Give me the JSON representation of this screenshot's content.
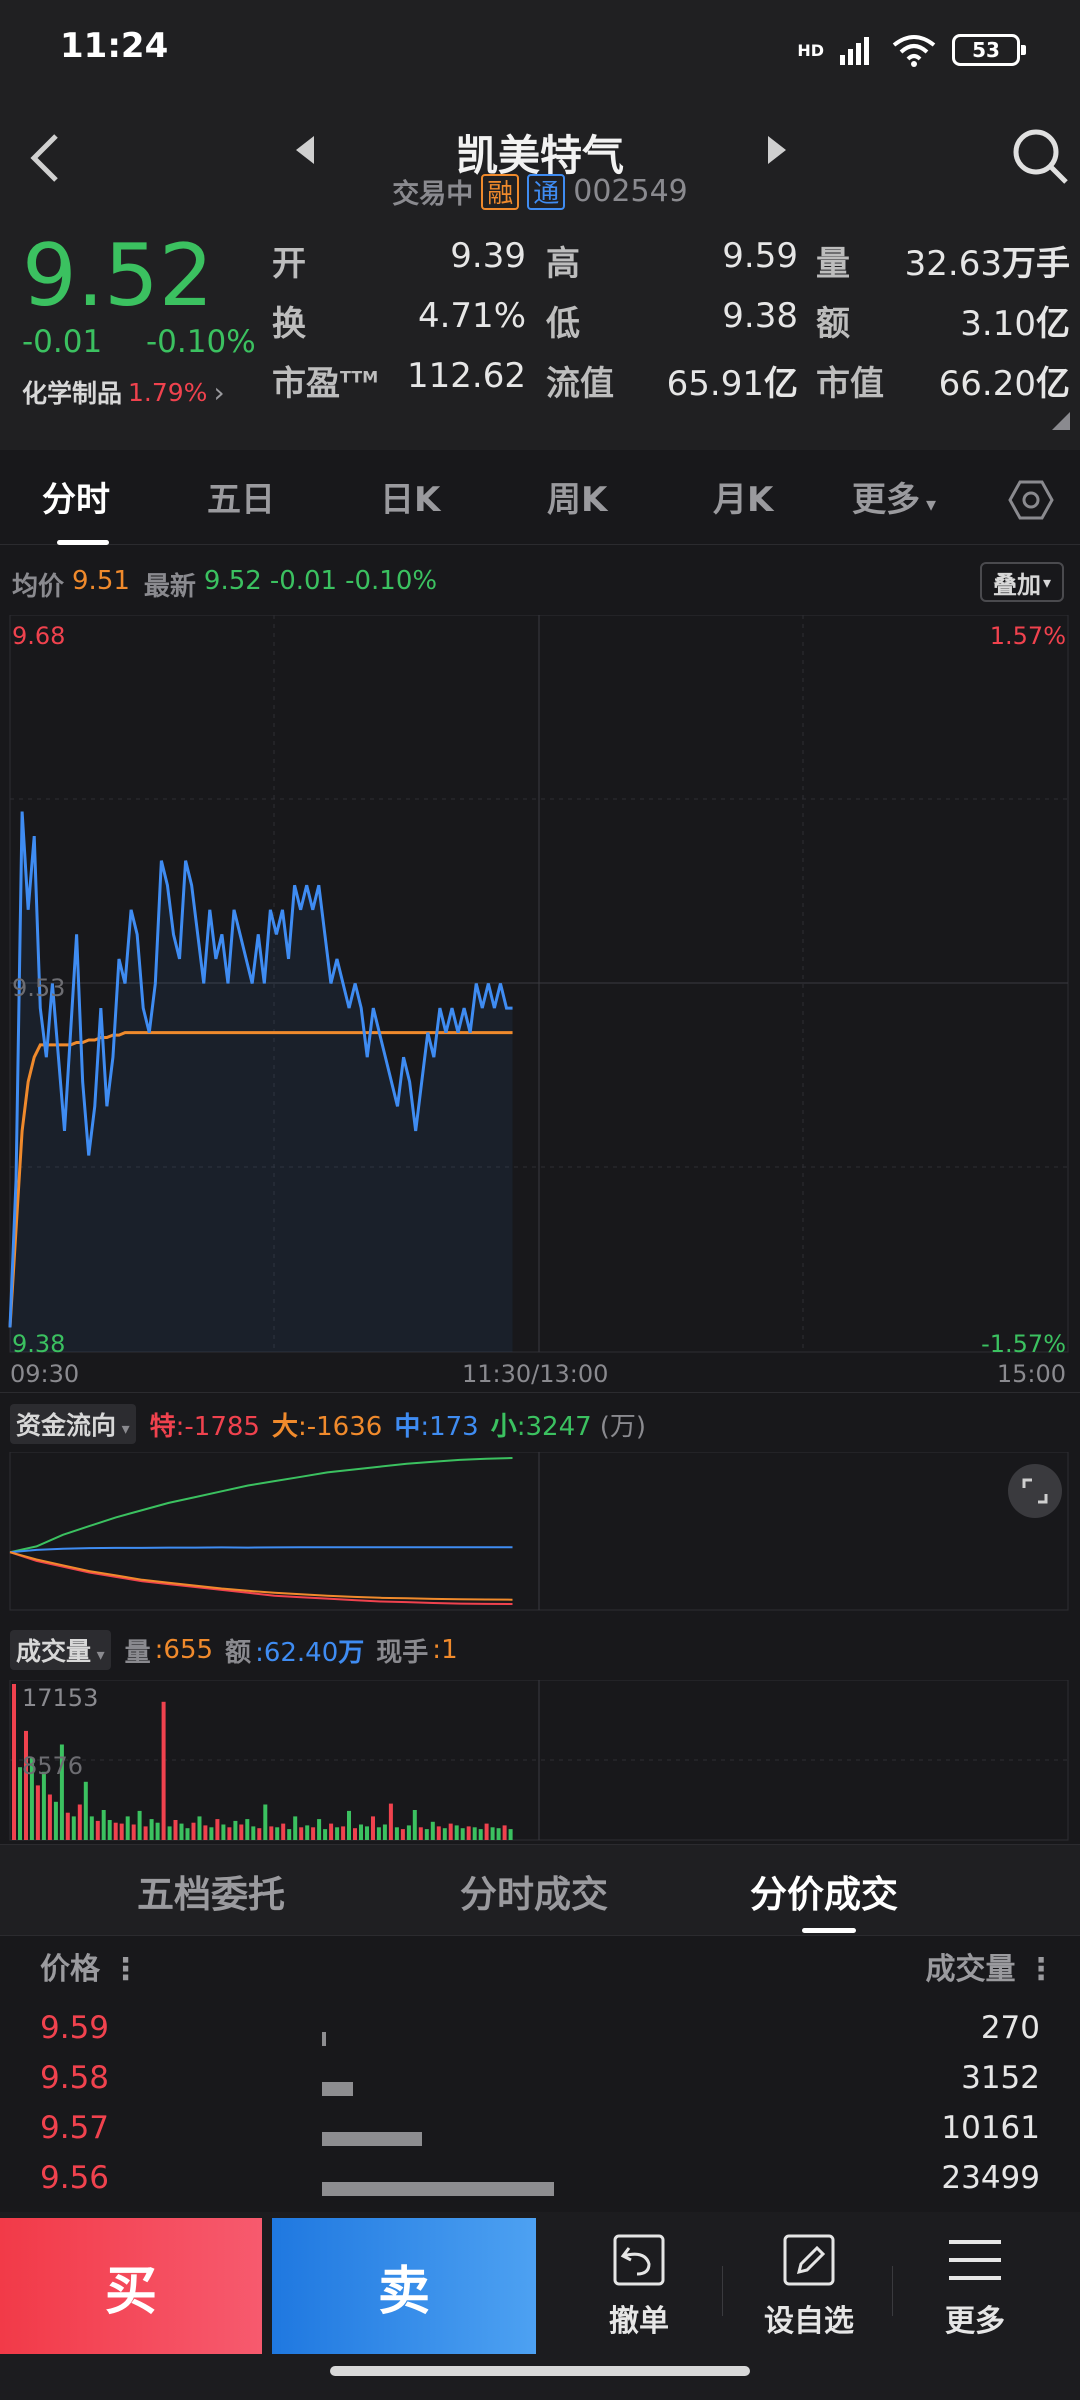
{
  "status_bar": {
    "time": "11:24",
    "network": "HD",
    "battery": "53"
  },
  "header": {
    "stock_name": "凯美特气",
    "trading_status": "交易中",
    "tag_rong": "融",
    "tag_tong": "通",
    "code": "002549",
    "price": "9.52",
    "change_abs": "-0.01",
    "change_pct": "-0.10%",
    "sector_name": "化学制品",
    "sector_change": "1.79%",
    "stats": [
      {
        "label": "开",
        "value": "9.39",
        "color": "green"
      },
      {
        "label": "高",
        "value": "9.59",
        "color": "red"
      },
      {
        "label": "量",
        "value": "32.63",
        "unit": "万手",
        "color": "white"
      },
      {
        "label": "换",
        "value": "4.71%",
        "color": "white"
      },
      {
        "label": "低",
        "value": "9.38",
        "color": "green"
      },
      {
        "label": "额",
        "value": "3.10",
        "unit": "亿",
        "color": "white"
      },
      {
        "label": "市盈",
        "label_sup": "TTM",
        "value": "112.62",
        "color": "white"
      },
      {
        "label": "流值",
        "value": "65.91",
        "unit": "亿",
        "color": "white"
      },
      {
        "label": "市值",
        "value": "66.20",
        "unit": "亿",
        "color": "white"
      }
    ]
  },
  "tabs": [
    "分时",
    "五日",
    "日K",
    "周K",
    "月K",
    "更多"
  ],
  "active_tab": "分时",
  "intraday_info": {
    "avg_label": "均价",
    "avg_value": "9.51",
    "latest_label": "最新",
    "latest_value": "9.52",
    "change_abs": "-0.01",
    "change_pct": "-0.10%",
    "overlay_label": "叠加"
  },
  "chart_data": [
    {
      "type": "line",
      "x_ticks": [
        "09:30",
        "11:30/13:00",
        "15:00"
      ],
      "y_max": "9.68",
      "y_min": "9.38",
      "y_mid": "9.53",
      "pct_max": "1.57%",
      "pct_min": "-1.57%",
      "ylim": [
        9.38,
        9.68
      ],
      "series": [
        {
          "key": "price",
          "color": "#3f8cf2",
          "values": [
            9.39,
            9.45,
            9.6,
            9.56,
            9.59,
            9.52,
            9.5,
            9.53,
            9.5,
            9.47,
            9.51,
            9.55,
            9.49,
            9.46,
            9.48,
            9.52,
            9.48,
            9.5,
            9.54,
            9.53,
            9.56,
            9.55,
            9.52,
            9.51,
            9.53,
            9.58,
            9.57,
            9.55,
            9.54,
            9.58,
            9.57,
            9.55,
            9.53,
            9.56,
            9.54,
            9.55,
            9.53,
            9.56,
            9.55,
            9.54,
            9.53,
            9.55,
            9.53,
            9.56,
            9.55,
            9.56,
            9.54,
            9.57,
            9.56,
            9.57,
            9.56,
            9.57,
            9.55,
            9.53,
            9.54,
            9.53,
            9.52,
            9.53,
            9.52,
            9.5,
            9.52,
            9.51,
            9.5,
            9.49,
            9.48,
            9.5,
            9.49,
            9.47,
            9.49,
            9.51,
            9.5,
            9.52,
            9.51,
            9.52,
            9.51,
            9.52,
            9.51,
            9.53,
            9.52,
            9.53,
            9.52,
            9.53,
            9.52,
            9.52
          ]
        },
        {
          "key": "avg",
          "color": "#f08a2c",
          "values": [
            9.39,
            9.43,
            9.47,
            9.49,
            9.5,
            9.505,
            9.505,
            9.505,
            9.505,
            9.505,
            9.505,
            9.506,
            9.506,
            9.507,
            9.507,
            9.508,
            9.508,
            9.509,
            9.509,
            9.51,
            9.51,
            9.51,
            9.51,
            9.51,
            9.51,
            9.51,
            9.51,
            9.51,
            9.51,
            9.51,
            9.51,
            9.51,
            9.51,
            9.51,
            9.51,
            9.51,
            9.51,
            9.51,
            9.51,
            9.51,
            9.51,
            9.51,
            9.51,
            9.51,
            9.51,
            9.51,
            9.51,
            9.51,
            9.51,
            9.51,
            9.51,
            9.51,
            9.51,
            9.51,
            9.51,
            9.51,
            9.51,
            9.51,
            9.51,
            9.51,
            9.51,
            9.51,
            9.51,
            9.51,
            9.51,
            9.51,
            9.51,
            9.51,
            9.51,
            9.51,
            9.51,
            9.51,
            9.51,
            9.51,
            9.51,
            9.51,
            9.51,
            9.51,
            9.51,
            9.51,
            9.51,
            9.51,
            9.51,
            9.51
          ]
        }
      ]
    },
    {
      "type": "line",
      "series": [
        {
          "key": "small",
          "color": "#3bc160",
          "values": [
            0,
            200,
            600,
            900,
            1200,
            1450,
            1700,
            1900,
            2100,
            2300,
            2450,
            2600,
            2750,
            2850,
            2950,
            3050,
            3120,
            3180,
            3220,
            3247
          ]
        },
        {
          "key": "mid",
          "color": "#3f8cf2",
          "values": [
            0,
            80,
            120,
            140,
            150,
            150,
            160,
            160,
            165,
            160,
            165,
            168,
            170,
            168,
            170,
            172,
            170,
            172,
            172,
            173
          ]
        },
        {
          "key": "super",
          "color": "#f0424e",
          "values": [
            0,
            -300,
            -500,
            -700,
            -850,
            -1000,
            -1100,
            -1200,
            -1300,
            -1400,
            -1500,
            -1550,
            -1600,
            -1650,
            -1700,
            -1720,
            -1750,
            -1770,
            -1780,
            -1785
          ]
        },
        {
          "key": "large",
          "color": "#f08a2c",
          "values": [
            0,
            -250,
            -450,
            -650,
            -800,
            -950,
            -1050,
            -1150,
            -1250,
            -1330,
            -1400,
            -1450,
            -1500,
            -1540,
            -1570,
            -1590,
            -1610,
            -1620,
            -1630,
            -1636
          ]
        }
      ]
    },
    {
      "type": "bar",
      "y_max_label": "17153",
      "y_mid_label": "8576",
      "ylim": [
        0,
        17153
      ],
      "values": [
        17153,
        8000,
        12000,
        9000,
        6000,
        7500,
        5000,
        4200,
        10500,
        3000,
        2600,
        3900,
        6400,
        2600,
        2100,
        3300,
        2200,
        1900,
        1800,
        2600,
        1700,
        3200,
        1500,
        2300,
        1900,
        15200,
        1500,
        2200,
        1800,
        1300,
        1900,
        2600,
        1600,
        1400,
        2300,
        1700,
        1400,
        2100,
        1700,
        2300,
        1500,
        1300,
        3900,
        1500,
        1400,
        1800,
        1200,
        2600,
        1400,
        1600,
        1400,
        2300,
        1200,
        1800,
        1400,
        1500,
        3200,
        1300,
        1700,
        1500,
        2600,
        1400,
        1700,
        4000,
        1400,
        1200,
        1600,
        3300,
        1400,
        1200,
        2000,
        1500,
        1300,
        1800,
        1600,
        1300,
        1500,
        1400,
        1200,
        1800,
        1400,
        1300,
        1600,
        1200
      ],
      "colors": [
        "r",
        "g",
        "r",
        "g",
        "r",
        "g",
        "r",
        "g",
        "g",
        "r",
        "g",
        "r",
        "g",
        "g",
        "r",
        "g",
        "g",
        "r",
        "r",
        "g",
        "r",
        "g",
        "r",
        "g",
        "g",
        "r",
        "g",
        "r",
        "g",
        "g",
        "r",
        "g",
        "r",
        "g",
        "r",
        "g",
        "r",
        "g",
        "r",
        "g",
        "g",
        "r",
        "g",
        "r",
        "g",
        "r",
        "g",
        "g",
        "r",
        "g",
        "r",
        "g",
        "g",
        "r",
        "g",
        "r",
        "g",
        "r",
        "g",
        "g",
        "r",
        "g",
        "g",
        "r",
        "g",
        "r",
        "g",
        "g",
        "r",
        "g",
        "g",
        "r",
        "g",
        "r",
        "g",
        "g",
        "r",
        "g",
        "g",
        "r",
        "g",
        "g",
        "r",
        "g"
      ]
    }
  ],
  "fund_flow": {
    "label": "资金流向",
    "super_label": "特",
    "super_value": "-1785",
    "large_label": "大",
    "large_value": "-1636",
    "mid_label": "中",
    "mid_value": "173",
    "small_label": "小",
    "small_value": "3247",
    "unit": "(万)"
  },
  "volume": {
    "label": "成交量",
    "qty_label": "量",
    "qty_value": "655",
    "amount_label": "额",
    "amount_value": "62.40",
    "amount_unit": "万",
    "hand_label": "现手",
    "hand_value": "1"
  },
  "bottom_tabs": [
    "五档委托",
    "分时成交",
    "分价成交"
  ],
  "bottom_active": "分价成交",
  "trades_header": {
    "price": "价格",
    "volume": "成交量"
  },
  "trades": [
    {
      "price": "9.59",
      "volume": "270",
      "ratio": 0.012
    },
    {
      "price": "9.58",
      "volume": "3152",
      "ratio": 0.134
    },
    {
      "price": "9.57",
      "volume": "10161",
      "ratio": 0.432
    },
    {
      "price": "9.56",
      "volume": "23499",
      "ratio": 1.0
    }
  ],
  "bottom_bar": {
    "buy": "买",
    "sell": "卖",
    "cancel": "撤单",
    "watchlist": "设自选",
    "more": "更多"
  }
}
